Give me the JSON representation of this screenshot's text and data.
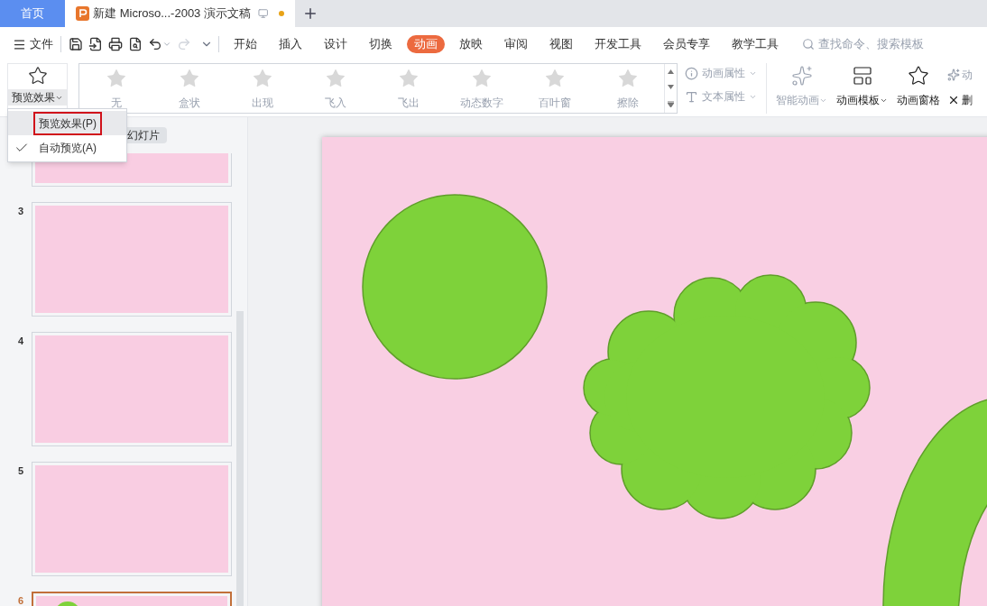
{
  "title_tabs": [
    {
      "kind": "home",
      "label": "首页"
    },
    {
      "kind": "document",
      "label": "新建 Microso...-2003 演示文稿",
      "unsaved": true
    }
  ],
  "menu": {
    "file_label": "文件",
    "tabs": [
      {
        "label": "开始",
        "selected": false
      },
      {
        "label": "插入",
        "selected": false
      },
      {
        "label": "设计",
        "selected": false
      },
      {
        "label": "切换",
        "selected": false
      },
      {
        "label": "动画",
        "selected": true
      },
      {
        "label": "放映",
        "selected": false
      },
      {
        "label": "审阅",
        "selected": false
      },
      {
        "label": "视图",
        "selected": false
      },
      {
        "label": "开发工具",
        "selected": false
      },
      {
        "label": "会员专享",
        "selected": false
      },
      {
        "label": "教学工具",
        "selected": false
      }
    ],
    "search": {
      "placeholder": "查找命令、搜索模板"
    }
  },
  "ribbon": {
    "preview_button": "预览效果",
    "effects": [
      {
        "label": "无",
        "disabled": true
      },
      {
        "label": "盒状",
        "disabled": true
      },
      {
        "label": "出现",
        "disabled": true
      },
      {
        "label": "飞入",
        "disabled": true
      },
      {
        "label": "飞出",
        "disabled": true
      },
      {
        "label": "动态数字",
        "disabled": true
      },
      {
        "label": "百叶窗",
        "disabled": true
      },
      {
        "label": "擦除",
        "disabled": true
      }
    ],
    "properties": [
      {
        "label": "动画属性",
        "disabled": true
      },
      {
        "label": "文本属性",
        "disabled": true
      }
    ],
    "tools": [
      {
        "label": "智能动画",
        "disabled": true,
        "dropdown": true
      },
      {
        "label": "动画模板",
        "disabled": false,
        "dropdown": true
      },
      {
        "label": "动画窗格",
        "disabled": false,
        "dropdown": false
      }
    ],
    "cut_tools": [
      "动",
      "删"
    ]
  },
  "preview_menu": [
    {
      "label": "预览效果(P)",
      "checked": false,
      "selected": true
    },
    {
      "label": "自动预览(A)",
      "checked": true,
      "selected": false
    }
  ],
  "slides_panel": {
    "new_slide_label": "幻灯片",
    "slides": [
      {
        "selected": false
      },
      {
        "number": "3",
        "selected": false
      },
      {
        "number": "4",
        "selected": false
      },
      {
        "number": "5",
        "selected": false
      },
      {
        "number": "6",
        "selected": true
      }
    ]
  }
}
